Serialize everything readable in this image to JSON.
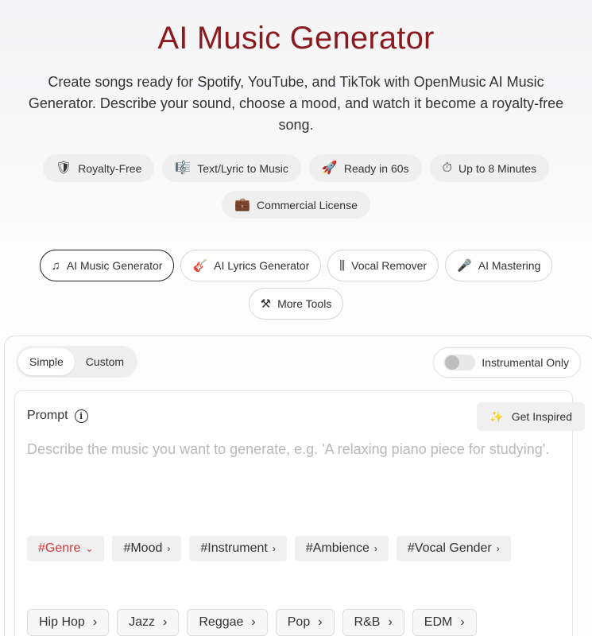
{
  "header": {
    "title": "AI Music Generator",
    "subtitle": "Create songs ready for Spotify, YouTube, and TikTok with OpenMusic AI Music Generator. Describe your sound, choose a mood, and watch it become a royalty-free song."
  },
  "features": [
    {
      "icon": "shield-icon",
      "glyph": "🛡",
      "label": "Royalty-Free"
    },
    {
      "icon": "music-notes-icon",
      "glyph": "🎼",
      "label": "Text/Lyric to Music"
    },
    {
      "icon": "rocket-icon",
      "glyph": "🚀",
      "label": "Ready in 60s"
    },
    {
      "icon": "stopwatch-icon",
      "glyph": "⏱",
      "label": "Up to 8 Minutes"
    },
    {
      "icon": "briefcase-icon",
      "glyph": "💼",
      "label": "Commercial License"
    }
  ],
  "tools": [
    {
      "icon": "music-note-icon",
      "glyph": "♫",
      "label": "AI Music Generator",
      "active": true
    },
    {
      "icon": "lyrics-icon",
      "glyph": "🎸",
      "label": "AI Lyrics Generator",
      "active": false
    },
    {
      "icon": "waveform-icon",
      "glyph": "⫼",
      "label": "Vocal Remover",
      "active": false
    },
    {
      "icon": "microphone-icon",
      "glyph": "🎤",
      "label": "AI Mastering",
      "active": false
    },
    {
      "icon": "tools-icon",
      "glyph": "⚒",
      "label": "More Tools",
      "active": false
    }
  ],
  "generator": {
    "modes": [
      "Simple",
      "Custom"
    ],
    "selected_mode": "Simple",
    "instrumental_label": "Instrumental Only",
    "instrumental_on": false,
    "prompt_label": "Prompt",
    "inspire_label": "Get Inspired",
    "prompt_placeholder": "Describe the music you want to generate, e.g. 'A relaxing piano piece for studying'.",
    "tags": [
      {
        "label": "#Genre",
        "chevron": "⌄",
        "active": true
      },
      {
        "label": "#Mood",
        "chevron": "›",
        "active": false
      },
      {
        "label": "#Instrument",
        "chevron": "›",
        "active": false
      },
      {
        "label": "#Ambience",
        "chevron": "›",
        "active": false
      },
      {
        "label": "#Vocal Gender",
        "chevron": "›",
        "active": false
      }
    ],
    "genres": [
      {
        "label": "Hip Hop",
        "chevron": "›"
      },
      {
        "label": "Jazz",
        "chevron": "›"
      },
      {
        "label": "Reggae",
        "chevron": "›"
      },
      {
        "label": "Pop",
        "chevron": "›"
      },
      {
        "label": "R&B",
        "chevron": "›"
      },
      {
        "label": "EDM",
        "chevron": "›"
      }
    ]
  },
  "colors": {
    "title": "#8b1a1f",
    "active_tag": "#d03a3a"
  }
}
